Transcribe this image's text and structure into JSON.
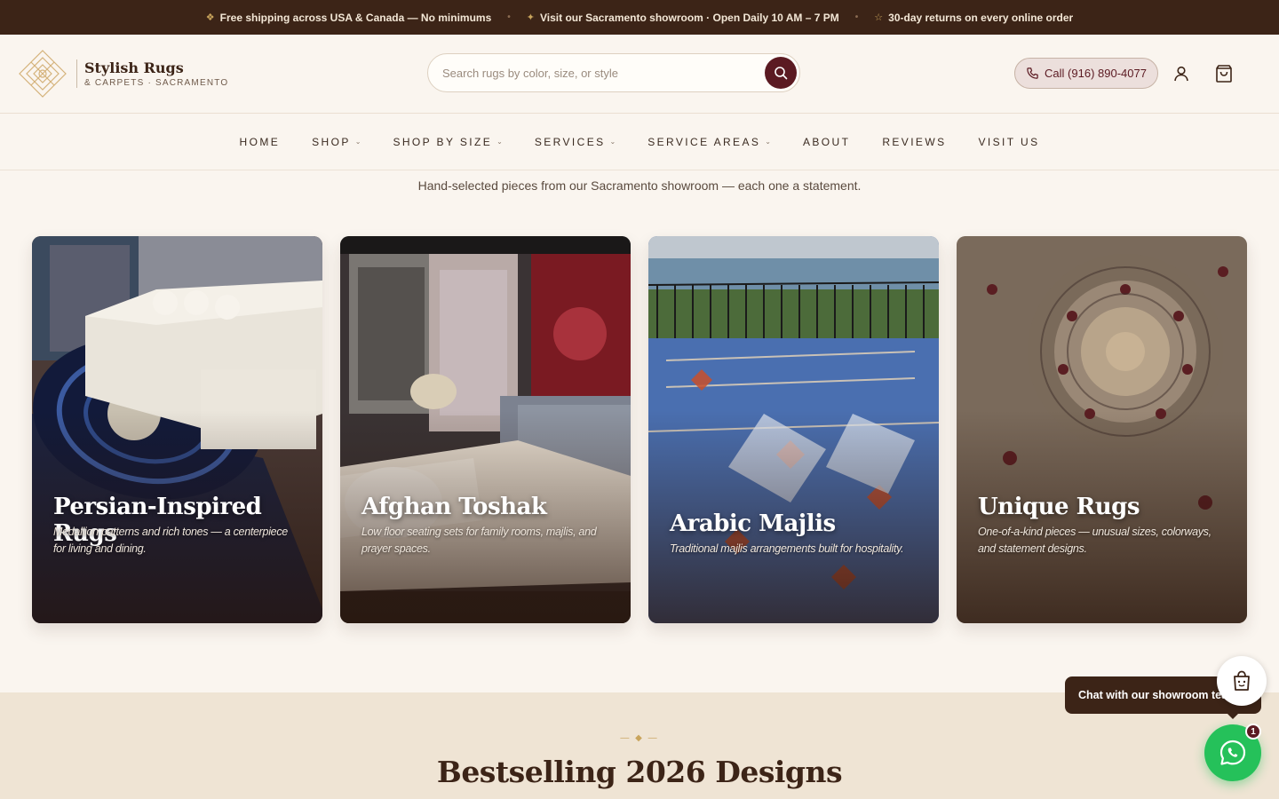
{
  "announcement": {
    "items": [
      {
        "glyph": "❖",
        "text": "Free shipping across USA & Canada — No minimums"
      },
      {
        "glyph": "✦",
        "text": "Visit our Sacramento showroom · Open Daily 10 AM – 7 PM"
      },
      {
        "glyph": "☆",
        "text": "30-day returns on every online order"
      }
    ]
  },
  "header": {
    "logo_name": "Stylish Rugs",
    "logo_sub": "& CARPETS · SACRAMENTO",
    "search_placeholder": "Search rugs by color, size, or style",
    "call_label": "Call (916) 890-4077"
  },
  "nav": [
    {
      "label": "HOME",
      "dropdown": false
    },
    {
      "label": "SHOP",
      "dropdown": true
    },
    {
      "label": "SHOP BY SIZE",
      "dropdown": true
    },
    {
      "label": "SERVICES",
      "dropdown": true
    },
    {
      "label": "SERVICE AREAS",
      "dropdown": true
    },
    {
      "label": "ABOUT",
      "dropdown": false
    },
    {
      "label": "REVIEWS",
      "dropdown": false
    },
    {
      "label": "VISIT US",
      "dropdown": false
    }
  ],
  "collections": {
    "subtitle": "Hand-selected pieces from our Sacramento showroom — each one a statement.",
    "cards": [
      {
        "title": "Persian-Inspired Rugs",
        "desc": "Medallion patterns and rich tones — a centerpiece for living and dining."
      },
      {
        "title": "Afghan Toshak",
        "desc": "Low floor seating sets for family rooms, majlis, and prayer spaces."
      },
      {
        "title": "Arabic Majlis",
        "desc": "Traditional majlis arrangements built for hospitality."
      },
      {
        "title": "Unique Rugs",
        "desc": "One-of-a-kind pieces — unusual sizes, colorways, and statement designs."
      }
    ]
  },
  "bestselling": {
    "ornament": "— ◆ —",
    "title": "Bestselling 2026 Designs"
  },
  "chat": {
    "label": "Chat with our showroom team",
    "badge_count": "1"
  },
  "colors": {
    "brand_dark": "#3c2417",
    "accent_maroon": "#5b1a22",
    "gold": "#c9a45c",
    "whatsapp": "#25c15a"
  }
}
